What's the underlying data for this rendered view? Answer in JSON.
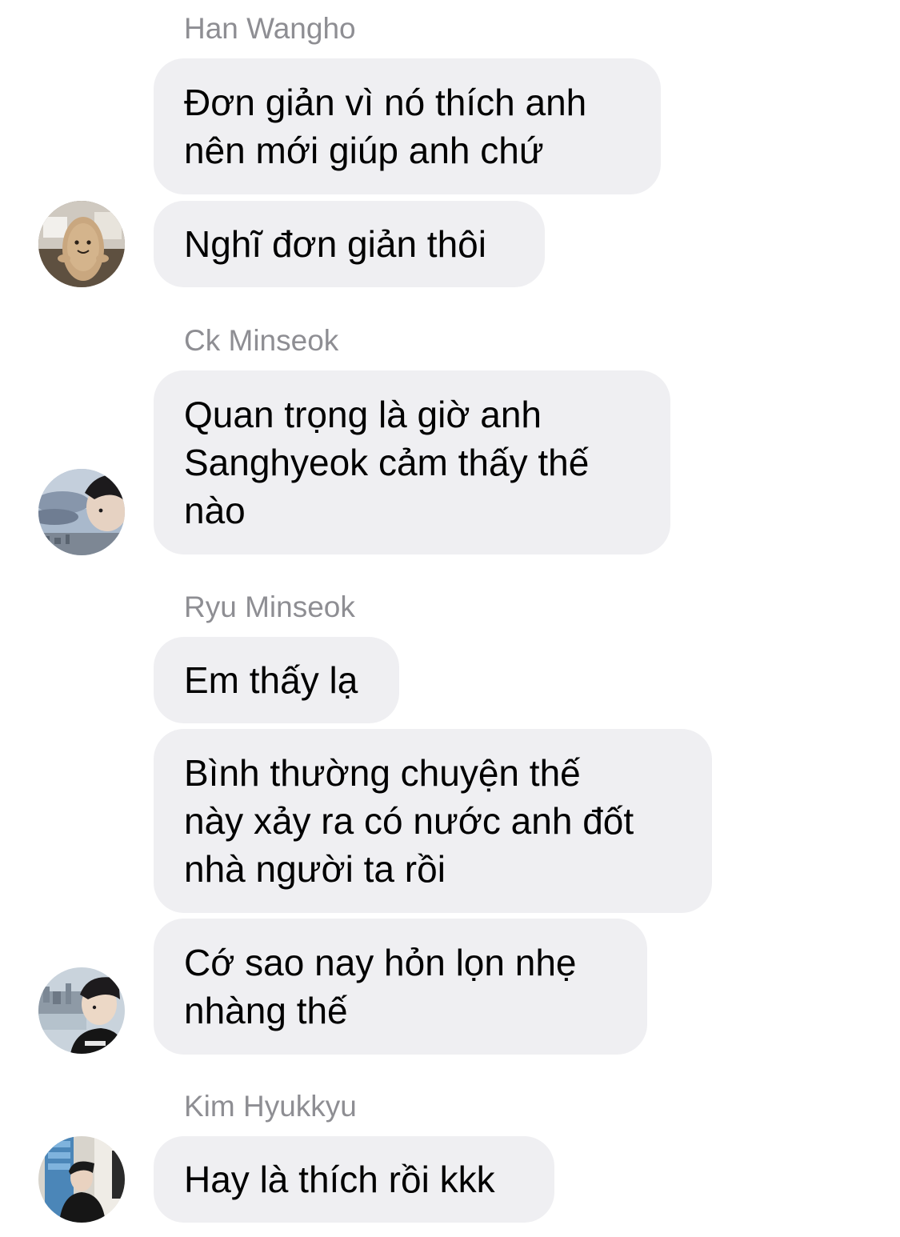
{
  "conversation": {
    "groups": [
      {
        "sender": "Han Wangho",
        "avatar_icon": "plush-toy-avatar",
        "messages": [
          "Đơn giản vì nó thích anh\nnên mới giúp anh chứ",
          "Nghĩ đơn giản thôi"
        ]
      },
      {
        "sender": "Ck Minseok",
        "avatar_icon": "person-sky-avatar",
        "messages": [
          "Quan trọng là giờ anh\nSanghyeok cảm thấy thế\nnào"
        ]
      },
      {
        "sender": "Ryu Minseok",
        "avatar_icon": "person-city-avatar",
        "messages": [
          "Em thấy lạ",
          "Bình thường chuyện thế\nnày xảy ra có nước anh đốt\nnhà người ta rồi",
          "Cớ sao nay hỏn lọn nhẹ\nnhàng thế"
        ]
      },
      {
        "sender": "Kim Hyukkyu",
        "avatar_icon": "person-store-avatar",
        "messages": [
          "Hay là thích rồi kkk"
        ]
      }
    ]
  },
  "colors": {
    "bubble_bg": "#efeff2",
    "sender_name": "#8e8e93",
    "message_text": "#000000",
    "background": "#ffffff"
  }
}
